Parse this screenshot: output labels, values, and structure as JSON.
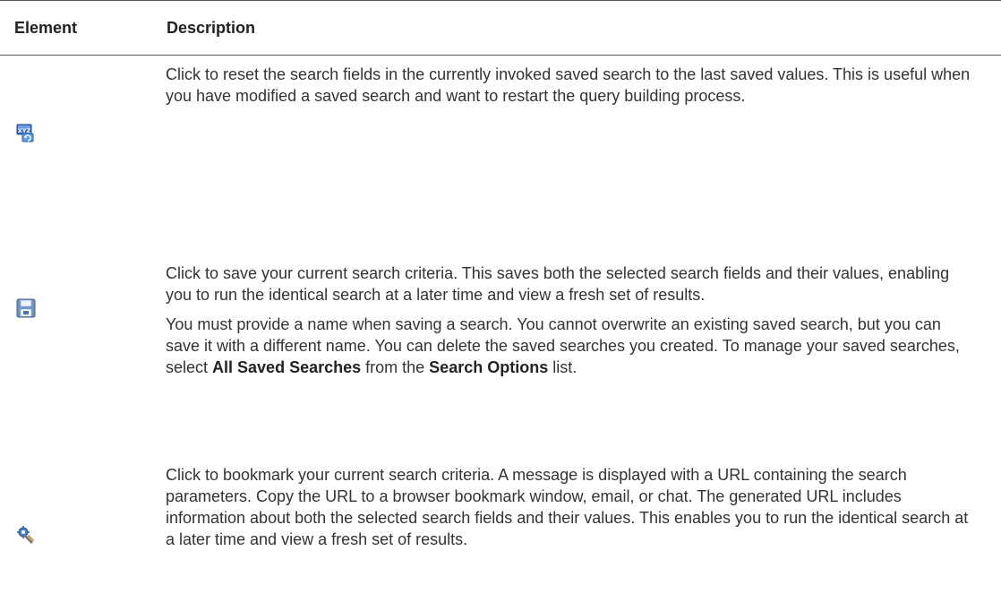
{
  "table": {
    "headers": {
      "element": "Element",
      "description": "Description"
    },
    "rows": [
      {
        "icon": "reset-search-icon",
        "paragraphs": [
          "Click to reset the search fields in the currently invoked saved search to the last saved values. This is useful when you have modified a saved search and want to restart the query building process."
        ]
      },
      {
        "icon": "save-disk-icon",
        "paragraphs": [
          "Click to save your current search criteria. This saves both the selected search fields and their values, enabling you to run the identical search at a later time and view a fresh set of results."
        ],
        "second_paragraph": {
          "part1": "You must provide a name when saving a search. You cannot overwrite an existing saved search, but you can save it with a different name. You can delete the saved searches you created. To manage your saved searches, select ",
          "bold1": "All Saved Searches",
          "part2": " from the ",
          "bold2": "Search Options",
          "part3": " list."
        }
      },
      {
        "icon": "bookmark-link-icon",
        "paragraphs": [
          "Click to bookmark your current search criteria. A message is displayed with a URL containing the search parameters. Copy the URL to a browser bookmark window, email, or chat. The generated URL includes information about both the selected search fields and their values. This enables you to run the identical search at a later time and view a fresh set of results."
        ]
      }
    ]
  }
}
